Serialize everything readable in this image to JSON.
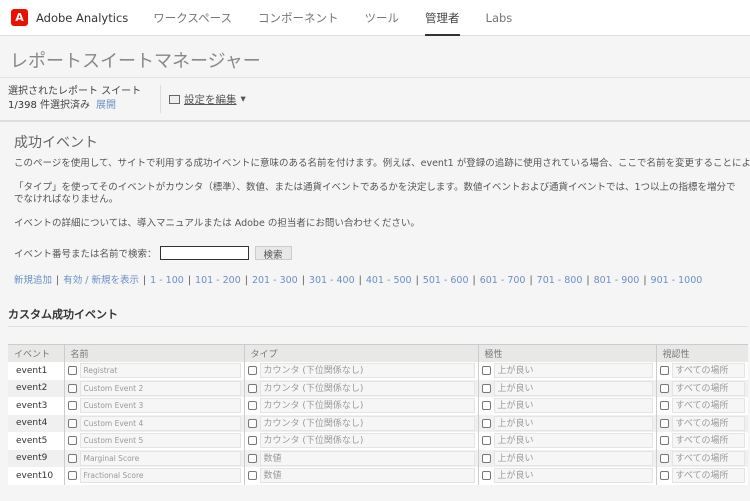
{
  "nav": {
    "brand": "Adobe Analytics",
    "items": [
      "ワークスペース",
      "コンポーネント",
      "ツール",
      "管理者",
      "Labs"
    ],
    "active": 3
  },
  "page_title": "レポートスイートマネージャー",
  "suite": {
    "label": "選択されたレポート スイート",
    "count": "1/398",
    "count_suffix": "件選択済み",
    "expand": "展開",
    "edit": "設定を編集"
  },
  "section": {
    "title": "成功イベント",
    "p1": "このページを使用して、サイトで利用する成功イベントに意味のある名前を付けます。例えば、event1 が登録の追跡に使用されている場合、ここで名前を変更することによ",
    "p2a": "「タイプ」を使ってそのイベントがカウンタ（標準）、数値、または通貨イベントであるかを決定します。数値イベントおよび通貨イベントでは、1つ以上の指標を増分で",
    "p2b": "でなければなりません。",
    "p3": "イベントの詳細については、導入マニュアルまたは Adobe の担当者にお問い合わせください。",
    "search_label": "イベント番号または名前で検索：",
    "search_value": "",
    "search_button": "検索",
    "links": [
      "新規追加",
      "有効 / 新規を表示",
      "1 - 100",
      "101 - 200",
      "201 - 300",
      "301 - 400",
      "401 - 500",
      "501 - 600",
      "601 - 700",
      "701 - 800",
      "801 - 900",
      "901 - 1000"
    ]
  },
  "table": {
    "title": "カスタム成功イベント",
    "headers": [
      "イベント",
      "名前",
      "タイプ",
      "極性",
      "視認性"
    ],
    "rows": [
      {
        "event": "event1",
        "name": "Registrat",
        "type": "カウンタ (下位関係なし)",
        "polarity": "上が良い",
        "visibility": "すべての場所"
      },
      {
        "event": "event2",
        "name": "Custom Event 2",
        "type": "カウンタ (下位関係なし)",
        "polarity": "上が良い",
        "visibility": "すべての場所"
      },
      {
        "event": "event3",
        "name": "Custom Event 3",
        "type": "カウンタ (下位関係なし)",
        "polarity": "上が良い",
        "visibility": "すべての場所"
      },
      {
        "event": "event4",
        "name": "Custom Event 4",
        "type": "カウンタ (下位関係なし)",
        "polarity": "上が良い",
        "visibility": "すべての場所"
      },
      {
        "event": "event5",
        "name": "Custom Event 5",
        "type": "カウンタ (下位関係なし)",
        "polarity": "上が良い",
        "visibility": "すべての場所"
      },
      {
        "event": "event9",
        "name": "Marginal Score",
        "type": "数値",
        "polarity": "上が良い",
        "visibility": "すべての場所"
      },
      {
        "event": "event10",
        "name": "Fractional Score",
        "type": "数値",
        "polarity": "上が良い",
        "visibility": "すべての場所"
      }
    ]
  }
}
